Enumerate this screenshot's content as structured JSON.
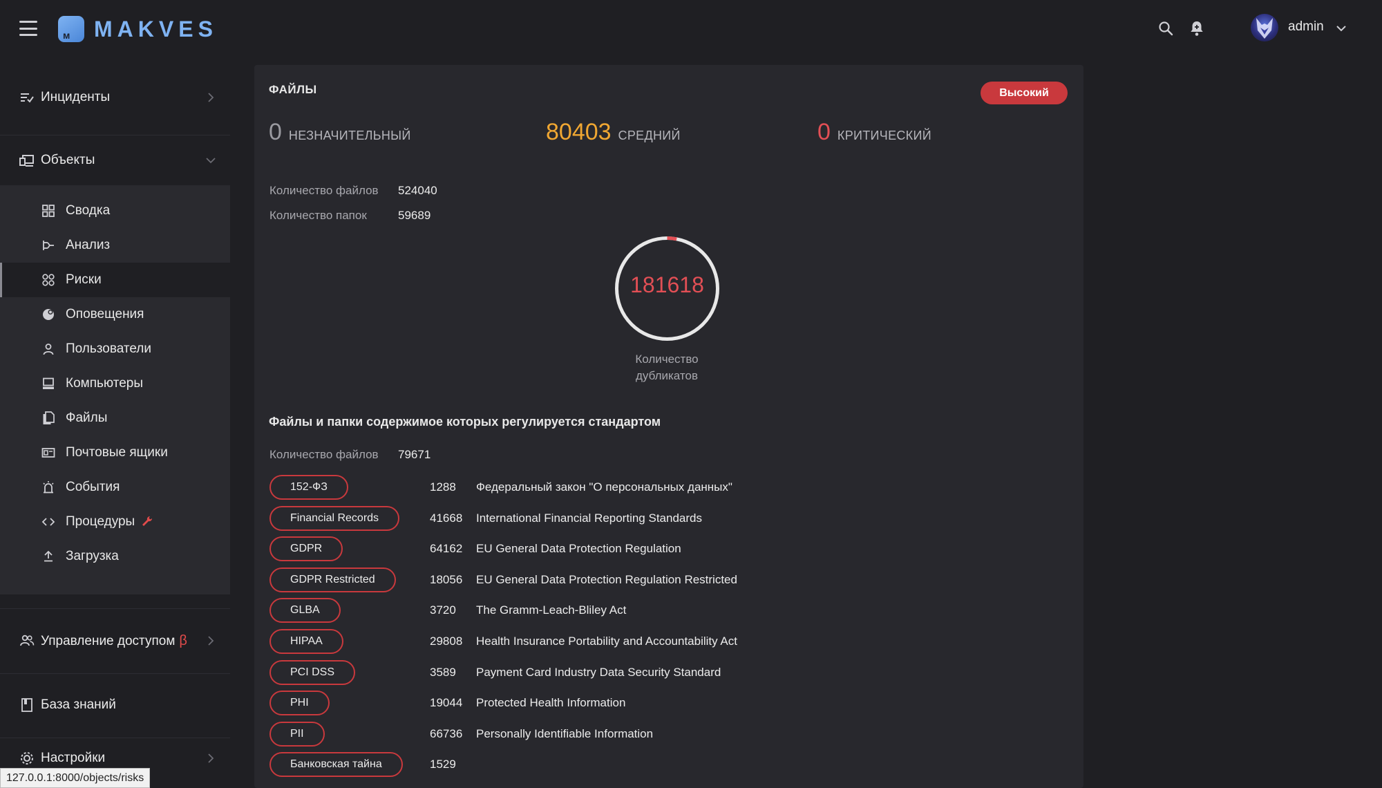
{
  "header": {
    "logo_text": "MAKVES",
    "username": "admin"
  },
  "sidebar": {
    "sections": {
      "incidents": "Инциденты",
      "objects": "Объекты",
      "access": "Управление доступом",
      "access_badge": "β",
      "knowledge": "База знаний",
      "settings": "Настройки"
    },
    "items": [
      {
        "label": "Сводка",
        "icon": "grid-icon"
      },
      {
        "label": "Анализ",
        "icon": "analysis-icon"
      },
      {
        "label": "Риски",
        "icon": "risks-icon",
        "active": true
      },
      {
        "label": "Оповещения",
        "icon": "notifications-icon"
      },
      {
        "label": "Пользователи",
        "icon": "user-icon"
      },
      {
        "label": "Компьютеры",
        "icon": "computer-icon"
      },
      {
        "label": "Файлы",
        "icon": "files-icon"
      },
      {
        "label": "Почтовые ящики",
        "icon": "mailbox-icon"
      },
      {
        "label": "События",
        "icon": "events-icon"
      },
      {
        "label": "Процедуры",
        "icon": "code-icon",
        "badge_icon": "wrench-icon"
      },
      {
        "label": "Загрузка",
        "icon": "upload-icon"
      }
    ]
  },
  "card": {
    "title": "ФАЙЛЫ",
    "risk_badge": "Высокий",
    "stats": {
      "low_value": "0",
      "low_label": "НЕЗНАЧИТЕЛЬНЫЙ",
      "medium_value": "80403",
      "medium_label": "СРЕДНИЙ",
      "critical_value": "0",
      "critical_label": "КРИТИЧЕСКИЙ"
    },
    "files_count_label": "Количество файлов",
    "files_count_value": "524040",
    "folders_count_label": "Количество папок",
    "folders_count_value": "59689",
    "duplicates_value": "181618",
    "duplicates_caption_1": "Количество",
    "duplicates_caption_2": "дубликатов",
    "duplicates_ring_fraction": 0.97,
    "standards_heading": "Файлы и папки содержимое которых регулируется стандартом",
    "standards_files_label": "Количество файлов",
    "standards_files_value": "79671",
    "standards": [
      {
        "tag": "152-ФЗ",
        "count": "1288",
        "desc": "Федеральный закон \"О персональных данных\""
      },
      {
        "tag": "Financial Records",
        "count": "41668",
        "desc": "International Financial Reporting Standards"
      },
      {
        "tag": "GDPR",
        "count": "64162",
        "desc": "EU General Data Protection Regulation"
      },
      {
        "tag": "GDPR Restricted",
        "count": "18056",
        "desc": "EU General Data Protection Regulation Restricted"
      },
      {
        "tag": "GLBA",
        "count": "3720",
        "desc": "The Gramm-Leach-Bliley Act"
      },
      {
        "tag": "HIPAA",
        "count": "29808",
        "desc": "Health Insurance Portability and Accountability Act"
      },
      {
        "tag": "PCI DSS",
        "count": "3589",
        "desc": "Payment Card Industry Data Security Standard"
      },
      {
        "tag": "PHI",
        "count": "19044",
        "desc": "Protected Health Information"
      },
      {
        "tag": "PII",
        "count": "66736",
        "desc": "Personally Identifiable Information"
      },
      {
        "tag": "Банковская тайна",
        "count": "1529",
        "desc": ""
      }
    ]
  },
  "status_bar": {
    "url": "127.0.0.1:8000/objects/risks"
  },
  "colors": {
    "accent_red": "#c9393d",
    "medium_orange": "#f0a732",
    "logo_blue": "#7fb3f2"
  }
}
